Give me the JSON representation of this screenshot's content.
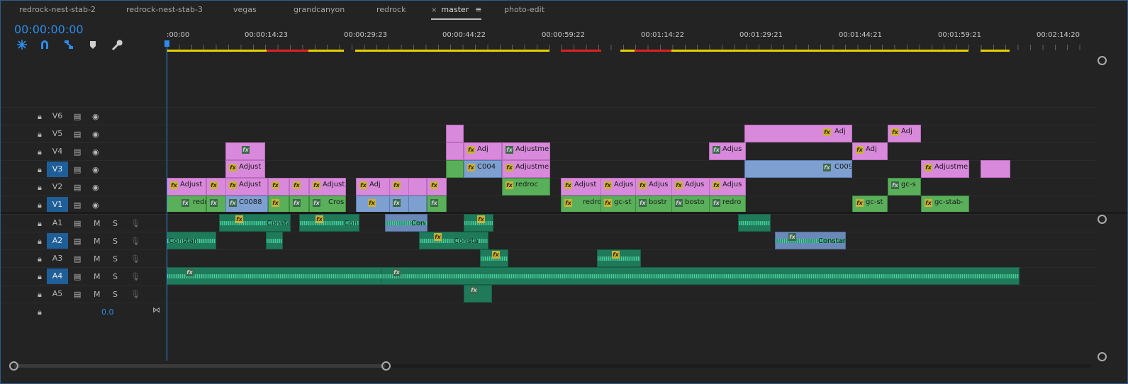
{
  "tabs": [
    {
      "label": "redrock-nest-stab-2"
    },
    {
      "label": "redrock-nest-stab-3"
    },
    {
      "label": "vegas"
    },
    {
      "label": "grandcanyon"
    },
    {
      "label": "redrock"
    },
    {
      "label": "master",
      "close": "×",
      "menu": "≡"
    },
    {
      "label": "photo-edit"
    }
  ],
  "timecode": "00:00:00:00",
  "ruler": [
    ":00:00",
    "00:00:14:23",
    "00:00:29:23",
    "00:00:44:22",
    "00:00:59:22",
    "00:01:14:22",
    "00:01:29:21",
    "00:01:44:21",
    "00:01:59:21",
    "00:02:14:20"
  ],
  "video_tracks": [
    {
      "label": "V6"
    },
    {
      "label": "V5"
    },
    {
      "label": "V4"
    },
    {
      "label": "V3",
      "on": true
    },
    {
      "label": "V2"
    },
    {
      "label": "V1",
      "on": true
    }
  ],
  "audio_tracks": [
    {
      "label": "A1"
    },
    {
      "label": "A2",
      "on": true
    },
    {
      "label": "A3"
    },
    {
      "label": "A4",
      "on": true
    },
    {
      "label": "A5"
    }
  ],
  "mute": "M",
  "solo": "S",
  "master_volume": "0.0",
  "clip_labels": {
    "adjust": "Adjust",
    "adjustm": "Adjustme",
    "adj": "Adj",
    "adjus": "Adjus",
    "c0088": "C0088",
    "c004": "C004",
    "c009": "C009",
    "redr": "redr",
    "redro": "redro",
    "redroc": "redroc",
    "gcs": "gc-s",
    "gcst": "gc-st",
    "gcstab": "gc-stab-",
    "bostr": "bostr",
    "bosto": "bosto",
    "cros": "Cros",
    "constan": "Constan",
    "consta": "Consta",
    "cons": "Cons",
    "con": "Con",
    "c": "C",
    "fx": "fx"
  }
}
